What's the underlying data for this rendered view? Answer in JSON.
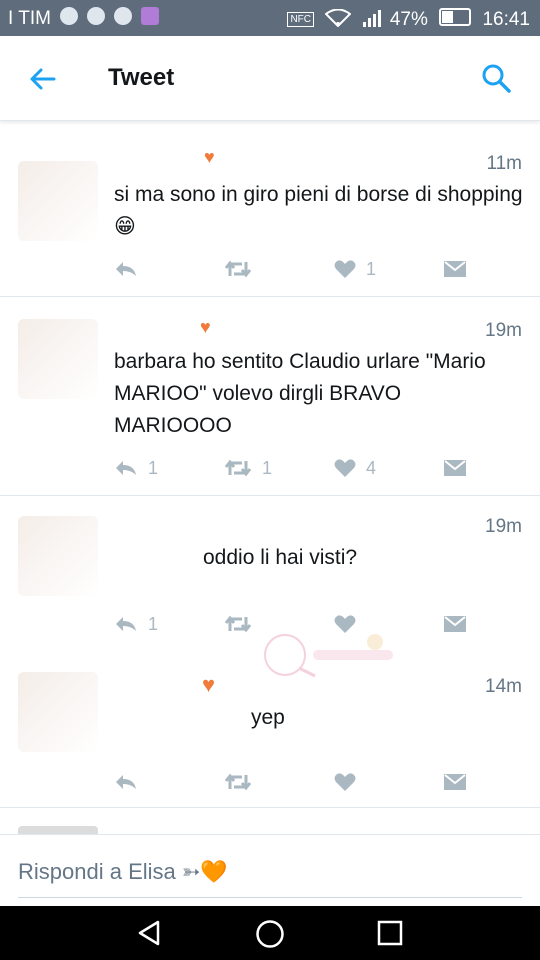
{
  "status_bar": {
    "carrier": "I TIM",
    "nfc": "NFC",
    "battery": "47%",
    "time": "16:41"
  },
  "header": {
    "title": "Tweet"
  },
  "tweets": [
    {
      "time": "11m",
      "text": "si ma sono in giro pieni di borse di shopping 😁",
      "reply_count": "",
      "retweet_count": "",
      "like_count": "1"
    },
    {
      "time": "19m",
      "text": "barbara ho sentito Claudio urlare \"Mario MARIOO\" volevo dirgli BRAVO MARIOOOO",
      "reply_count": "1",
      "retweet_count": "1",
      "like_count": "4"
    },
    {
      "time": "19m",
      "text": "oddio li hai visti?",
      "reply_count": "1",
      "retweet_count": "",
      "like_count": ""
    },
    {
      "time": "14m",
      "text": "yep",
      "reply_count": "",
      "retweet_count": "",
      "like_count": ""
    }
  ],
  "reply_bar": {
    "placeholder": "Rispondi a Elisa ➳🧡"
  },
  "colors": {
    "accent": "#1da1f2",
    "status_bar": "#5f6c7c",
    "icon_gray": "#aab8c2",
    "heart_orange": "#f07b3a"
  }
}
